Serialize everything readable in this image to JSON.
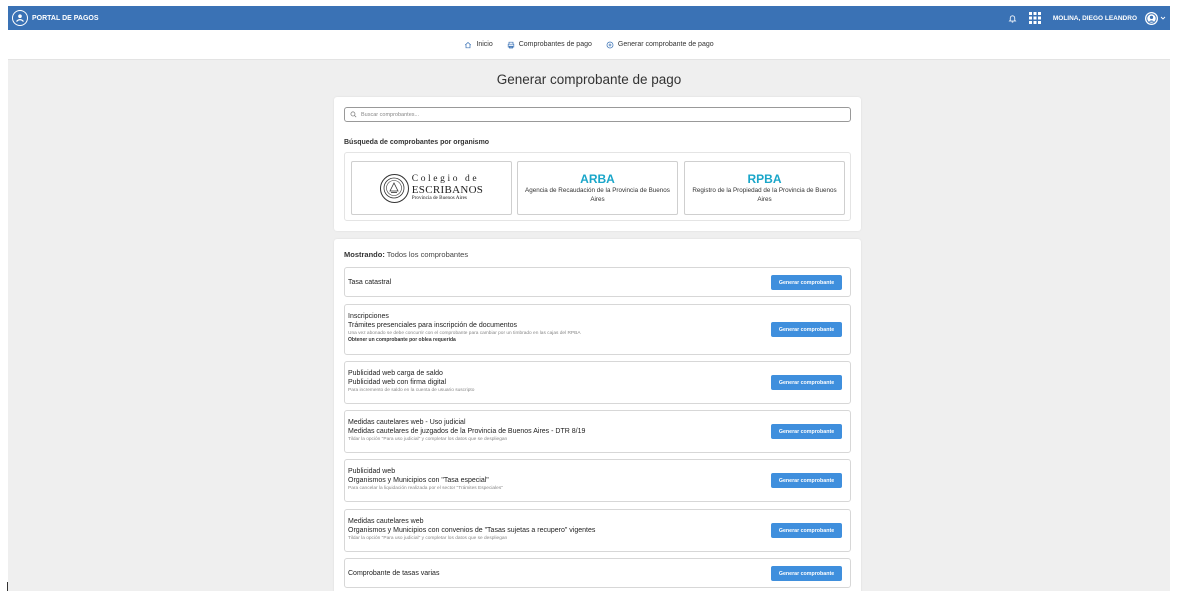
{
  "header": {
    "brand": "PORTAL DE PAGOS",
    "user_name": "MOLINA, DIEGO LEANDRO",
    "icons": [
      "bell-icon",
      "apps-grid-icon",
      "user-avatar-icon",
      "chevron-down-icon"
    ],
    "color": "#3a72b5"
  },
  "breadcrumb": [
    {
      "label": "Inicio",
      "icon": "home-icon"
    },
    {
      "label": "Comprobantes de pago",
      "icon": "printer-icon"
    },
    {
      "label": "Generar comprobante de pago",
      "icon": "plus-circle-icon"
    }
  ],
  "main": {
    "title": "Generar comprobante de pago",
    "search": {
      "placeholder": "Buscar comprobantes..."
    },
    "organisms_label": "Búsqueda de comprobantes por organismo",
    "organisms": [
      {
        "logo_lines": [
          "Colegio de",
          "ESCRIBANOS",
          "Provincia de Buenos Aires"
        ]
      },
      {
        "acronym": "ARBA",
        "description": "Agencia de Recaudación de la Provincia de Buenos Aires"
      },
      {
        "acronym": "RPBA",
        "description": "Registro de la Propiedad de la Provincia de Buenos Aires"
      }
    ],
    "showing_label": "Mostrando:",
    "showing_value": "Todos los comprobantes",
    "button_label": "Generar comprobante",
    "button_color": "#3f8fdd",
    "accent_color": "#1aa6c9",
    "vouchers": [
      {
        "title": "Tasa catastral"
      },
      {
        "title": "Inscripciones",
        "subtitle": "Trámites presenciales para inscripción de documentos",
        "note": "Una vez abonado se debe concurrir con el comprobante para cambiar por un timbrado en las cajas del RPBA",
        "link": "Obtener un comprobante por oblea requerida"
      },
      {
        "title": "Publicidad web carga de saldo",
        "subtitle": "Publicidad web con firma digital",
        "note": "Para incremento de saldo en la cuenta de usuario suscripto"
      },
      {
        "title": "Medidas cautelares web - Uso judicial",
        "subtitle": "Medidas cautelares de juzgados de la Provincia de Buenos Aires - DTR 8/19",
        "note": "Tildar la opción \"Para uso judicial\" y completar los datos que se despliegan"
      },
      {
        "title": "Publicidad web",
        "subtitle": "Organismos y Municipios con \"Tasa especial\"",
        "note": "Para cancelar la liquidación realizada por el sector \"Trámites Especiales\""
      },
      {
        "title": "Medidas cautelares web",
        "subtitle": "Organismos y Municipios con convenios de \"Tasas sujetas a recupero\" vigentes",
        "note": "Tildar la opción \"Para uso judicial\" y completar los datos que se despliegan"
      },
      {
        "title": "Comprobante de tasas varias"
      }
    ]
  }
}
